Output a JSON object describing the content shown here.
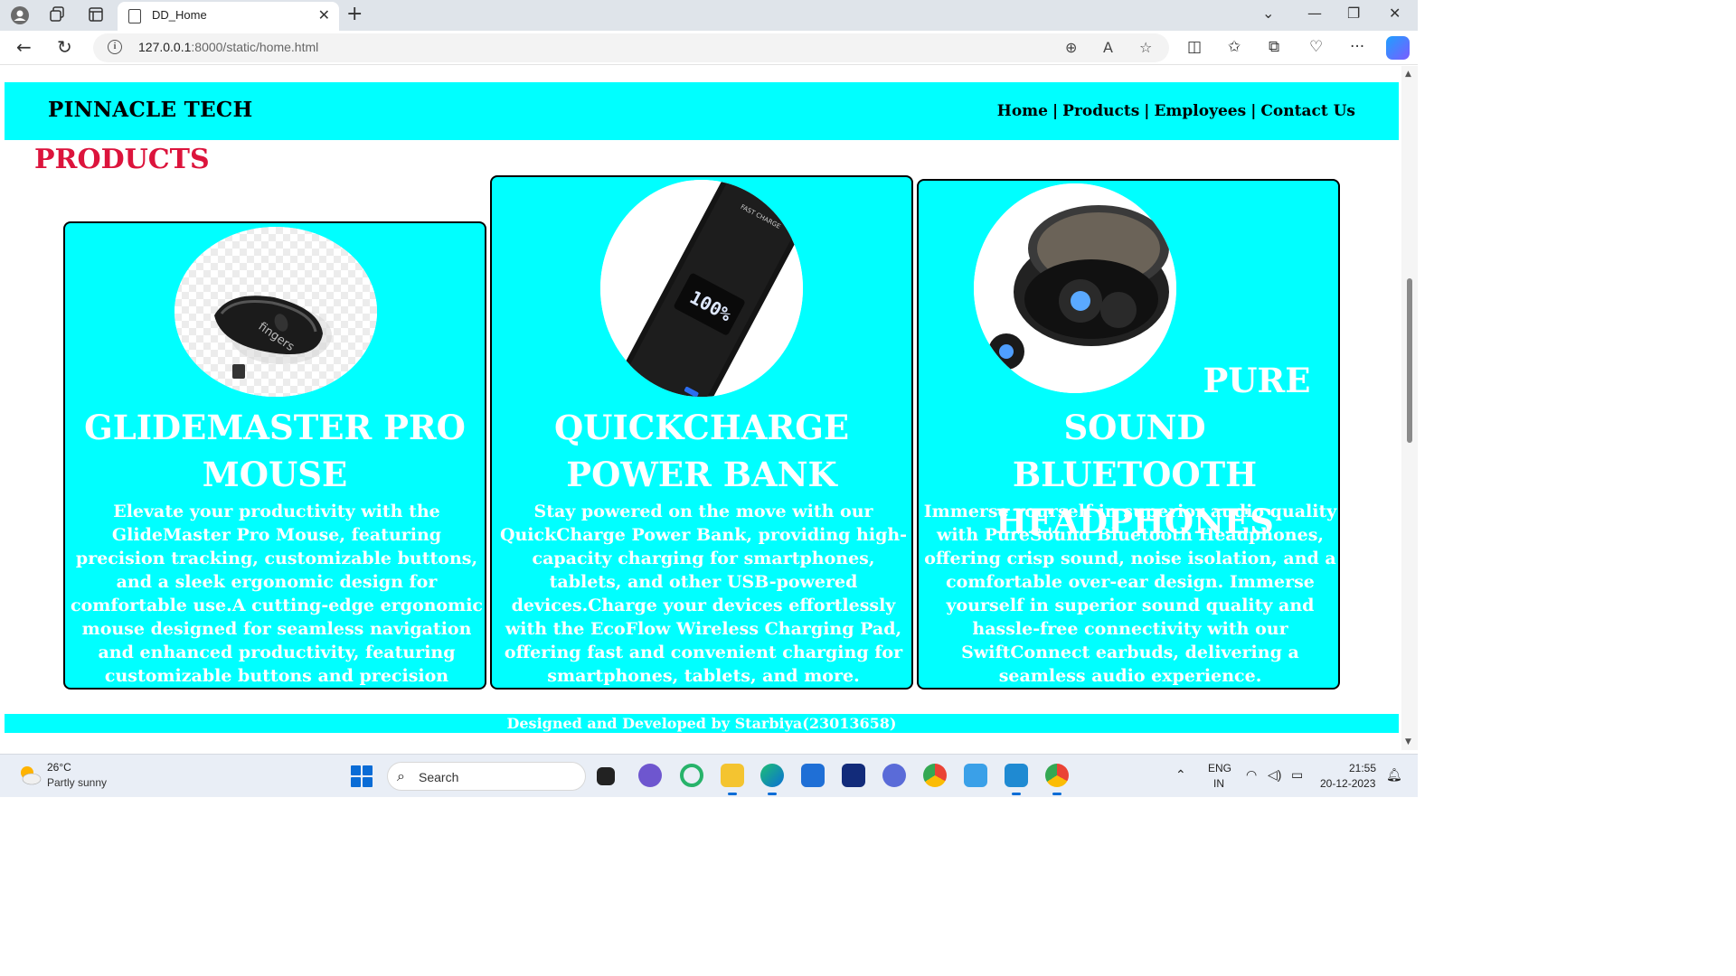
{
  "browser": {
    "tab_title": "DD_Home",
    "url_host": "127.0.0.1",
    "url_rest": ":8000/static/home.html"
  },
  "site": {
    "brand": "PINNACLE TECH",
    "nav": [
      "Home",
      "Products",
      "Employees",
      "Contact Us"
    ],
    "nav_separator": "|",
    "section_title": "PRODUCTS",
    "footer": "Designed and Developed by Starbiya(23013658)"
  },
  "products": [
    {
      "name": "GLIDEMASTER PRO MOUSE",
      "description": "Elevate your productivity with the GlideMaster Pro Mouse, featuring precision tracking, customizable buttons, and a sleek ergonomic design for comfortable use.A cutting-edge ergonomic mouse designed for seamless navigation and enhanced productivity, featuring customizable buttons and precision tracking.",
      "image_label": "fingers",
      "icon": "mouse-image"
    },
    {
      "name": "QUICKCHARGE POWER BANK",
      "description": "Stay powered on the move with our QuickCharge Power Bank, providing high-capacity charging for smartphones, tablets, and other USB-powered devices.Charge your devices effortlessly with the EcoFlow Wireless Charging Pad, offering fast and convenient charging for smartphones, tablets, and more.",
      "image_label": "100%",
      "image_label_2": "FAST CHARGE",
      "icon": "power-bank-image"
    },
    {
      "name": "PURE SOUND BLUETOOTH HEADPHONES",
      "description": "Immerse yourself in superior audio quality with PureSound Bluetooth Headphones, offering crisp sound, noise isolation, and a comfortable over-ear design. Immerse yourself in superior sound quality and hassle-free connectivity with our SwiftConnect earbuds, delivering a seamless audio experience.",
      "icon": "earbuds-image"
    }
  ],
  "taskbar": {
    "weather_temp": "26°C",
    "weather_desc": "Partly sunny",
    "search_label": "Search",
    "lang_line1": "ENG",
    "lang_line2": "IN",
    "time": "21:55",
    "date": "20-12-2023"
  },
  "colors": {
    "accent_cyan": "#00ffff",
    "heading_red": "#dc143c",
    "card_text": "#ffffff"
  }
}
